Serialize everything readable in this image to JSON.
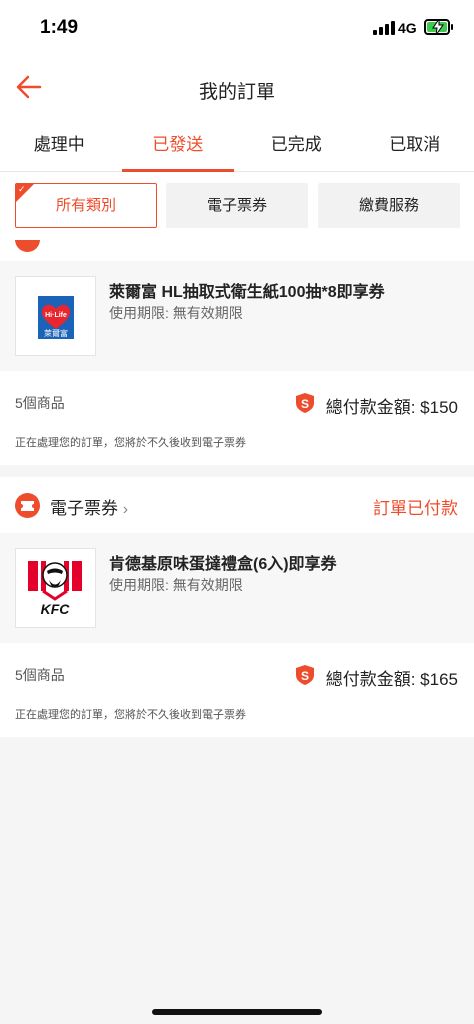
{
  "status_bar": {
    "time": "1:49",
    "network": "4G"
  },
  "header": {
    "title": "我的訂單"
  },
  "tabs": [
    {
      "label": "處理中",
      "active": false
    },
    {
      "label": "已發送",
      "active": true
    },
    {
      "label": "已完成",
      "active": false
    },
    {
      "label": "已取消",
      "active": false
    }
  ],
  "filters": [
    {
      "label": "所有類別",
      "active": true
    },
    {
      "label": "電子票券",
      "active": false
    },
    {
      "label": "繳費服務",
      "active": false
    }
  ],
  "orders": [
    {
      "shop_name": "",
      "status": "",
      "product": {
        "name": "萊爾富 HL抽取式衛生紙100抽*8即享券",
        "validity": "使用期限: 無有效期限",
        "thumbnail": "hilife-logo",
        "logo_text": "萊爾富"
      },
      "item_count": "5個商品",
      "total": "總付款金額: $150",
      "note": "正在處理您的訂單，您將於不久後收到電子票券"
    },
    {
      "shop_name": "電子票券",
      "status": "訂單已付款",
      "product": {
        "name": "肯德基原味蛋撻禮盒(6入)即享券",
        "validity": "使用期限: 無有效期限",
        "thumbnail": "kfc-logo",
        "logo_text": "KFC"
      },
      "item_count": "5個商品",
      "total": "總付款金額: $165",
      "note": "正在處理您的訂單，您將於不久後收到電子票券"
    }
  ],
  "colors": {
    "accent": "#ee4d2d",
    "background": "#f5f5f5"
  }
}
